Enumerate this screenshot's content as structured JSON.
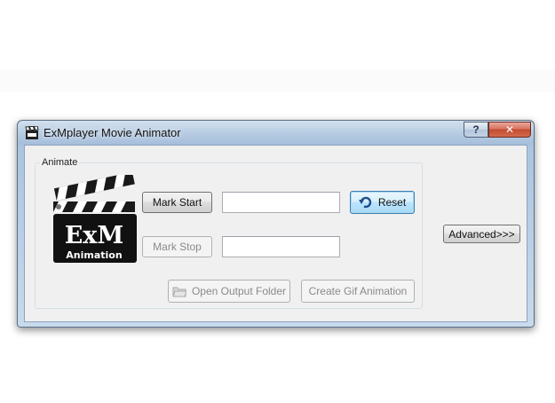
{
  "window": {
    "title": "ExMplayer Movie Animator",
    "help_symbol": "?",
    "close_symbol": "✕"
  },
  "animate_group": {
    "title": "Animate",
    "logo_text": "ExM",
    "logo_subtext": "Animation"
  },
  "buttons": {
    "mark_start": "Mark Start",
    "mark_stop": "Mark Stop",
    "reset": "Reset",
    "open_output_folder": "Open Output Folder",
    "create_gif": "Create Gif Animation",
    "advanced": "Advanced>>>"
  },
  "fields": {
    "start_value": "",
    "stop_value": ""
  },
  "icons": {
    "app": "clapperboard-icon",
    "reset": "undo-arrow-icon",
    "folder": "folder-icon"
  },
  "colors": {
    "titlebar": "#b6cbe2",
    "close_button": "#c24a30",
    "focus_border": "#3c7fb1",
    "client_background": "#f0f0f0"
  }
}
